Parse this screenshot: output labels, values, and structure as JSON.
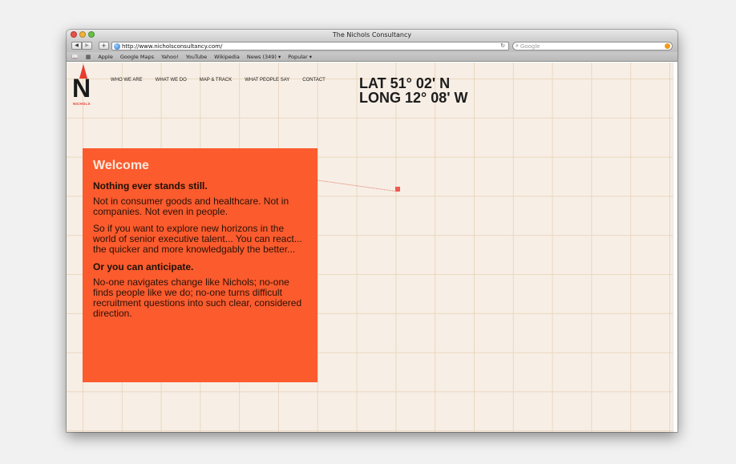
{
  "browser": {
    "title": "The Nichols Consultancy",
    "url": "http://www.nicholsconsultancy.com/",
    "search_placeholder": "Google",
    "bookmarks": [
      "Apple",
      "Google Maps",
      "Yahoo!",
      "YouTube",
      "Wikipedia",
      "News (349) ▾",
      "Popular ▾"
    ]
  },
  "site": {
    "logo_text": "NICHOLS",
    "nav": [
      "WHO WE ARE",
      "WHAT WE DO",
      "MAP & TRACK",
      "WHAT PEOPLE SAY",
      "CONTACT"
    ],
    "coords": {
      "lat": "LAT 51° 02' N",
      "long": "LONG 12° 08' W"
    },
    "welcome": {
      "title": "Welcome",
      "heading1": "Nothing ever stands still.",
      "para1": "Not in consumer goods and healthcare. Not in companies. Not even in people.",
      "para2": "So if you want to explore new horizons in the world of senior executive talent... You can react... the quicker and more knowledgably the better...",
      "heading2": "Or you can anticipate.",
      "para3": "No-one navigates change like Nichols; no-one finds people like we do; no-one turns difficult recruitment questions into such clear, considered direction."
    },
    "colors": {
      "accent": "#fb5b2d",
      "background": "#f7efe6",
      "grid": "#ead7bd",
      "marker": "#ef5a4f"
    }
  }
}
